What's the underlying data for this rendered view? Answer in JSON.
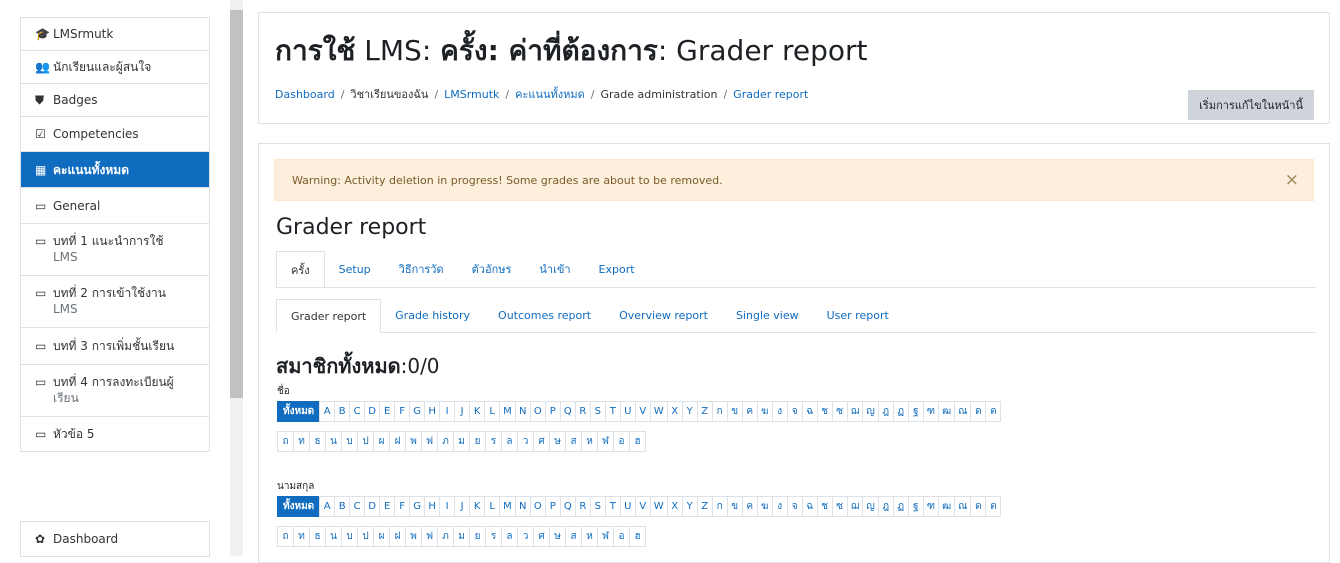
{
  "sidebar": {
    "items": [
      {
        "icon": "graduation-cap-icon",
        "glyph": "🎓",
        "label": "LMSrmutk"
      },
      {
        "icon": "users-icon",
        "glyph": "👥",
        "label": "นักเรียนและผู้สนใจ"
      },
      {
        "icon": "shield-icon",
        "glyph": "⛊",
        "label": "Badges"
      },
      {
        "icon": "checkbox-icon",
        "glyph": "☑",
        "label": "Competencies"
      },
      {
        "icon": "table-icon",
        "glyph": "▦",
        "label": "คะแนนทั้งหมด",
        "active": true
      },
      {
        "icon": "folder-icon",
        "glyph": "▭",
        "label": "General"
      },
      {
        "icon": "folder-icon",
        "glyph": "▭",
        "label": "บทที่ 1 แนะนำการใช้",
        "sub": "LMS"
      },
      {
        "icon": "folder-icon",
        "glyph": "▭",
        "label": "บทที่ 2 การเข้าใช้งาน",
        "sub": "LMS"
      },
      {
        "icon": "folder-icon",
        "glyph": "▭",
        "label": "บทที่ 3 การเพิ่มชั้นเรียน"
      },
      {
        "icon": "folder-icon",
        "glyph": "▭",
        "label": "บทที่ 4 การลงทะเบียนผู้",
        "sub": "เรียน"
      },
      {
        "icon": "folder-icon",
        "glyph": "▭",
        "label": "หัวข้อ 5"
      }
    ],
    "dashboard": {
      "icon": "dashboard-icon",
      "glyph": "✿",
      "label": "Dashboard"
    }
  },
  "header": {
    "title_bold_1": "การใช้",
    "title_plain_1": " LMS: ",
    "title_bold_2": "ครั้ง: ค่าที่ต้องการ",
    "title_plain_2": ": Grader report",
    "breadcrumb": [
      "Dashboard",
      "วิชาเรียนของฉัน",
      "LMSrmutk",
      "คะแนนทั้งหมด",
      "Grade administration",
      "Grader report"
    ],
    "edit_button": "เริ่มการแก้ไขในหน้านี้"
  },
  "main": {
    "warning": "Warning: Activity deletion in progress! Some grades are about to be removed.",
    "warning_close": "×",
    "heading": "Grader report",
    "tabs_primary": [
      "ครั้ง",
      "Setup",
      "วิธีการวัด",
      "ตัวอักษร",
      "นำเข้า",
      "Export"
    ],
    "tabs_secondary": [
      "Grader report",
      "Grade history",
      "Outcomes report",
      "Overview report",
      "Single view",
      "User report"
    ],
    "members_label": "สมาชิกทั้งหมด",
    "members_value": ":0/0",
    "firstname_label": "ชื่อ",
    "lastname_label": "นามสกุล",
    "all_label": "ทั้งหมด",
    "letters_row1": [
      "A",
      "B",
      "C",
      "D",
      "E",
      "F",
      "G",
      "H",
      "I",
      "J",
      "K",
      "L",
      "M",
      "N",
      "O",
      "P",
      "Q",
      "R",
      "S",
      "T",
      "U",
      "V",
      "W",
      "X",
      "Y",
      "Z",
      "ก",
      "ข",
      "ค",
      "ฆ",
      "ง",
      "จ",
      "ฉ",
      "ช",
      "ซ",
      "ฌ",
      "ญ",
      "ฎ",
      "ฏ",
      "ฐ",
      "ฑ",
      "ฒ",
      "ณ",
      "ด",
      "ต"
    ],
    "letters_row2": [
      "ถ",
      "ท",
      "ธ",
      "น",
      "บ",
      "ป",
      "ผ",
      "ฝ",
      "พ",
      "ฟ",
      "ภ",
      "ม",
      "ย",
      "ร",
      "ล",
      "ว",
      "ศ",
      "ษ",
      "ส",
      "ห",
      "ฬ",
      "อ",
      "ฮ"
    ]
  },
  "colors": {
    "accent": "#0f6cbf",
    "warning_bg": "#fcefdc",
    "warning_text": "#7d5a29"
  }
}
